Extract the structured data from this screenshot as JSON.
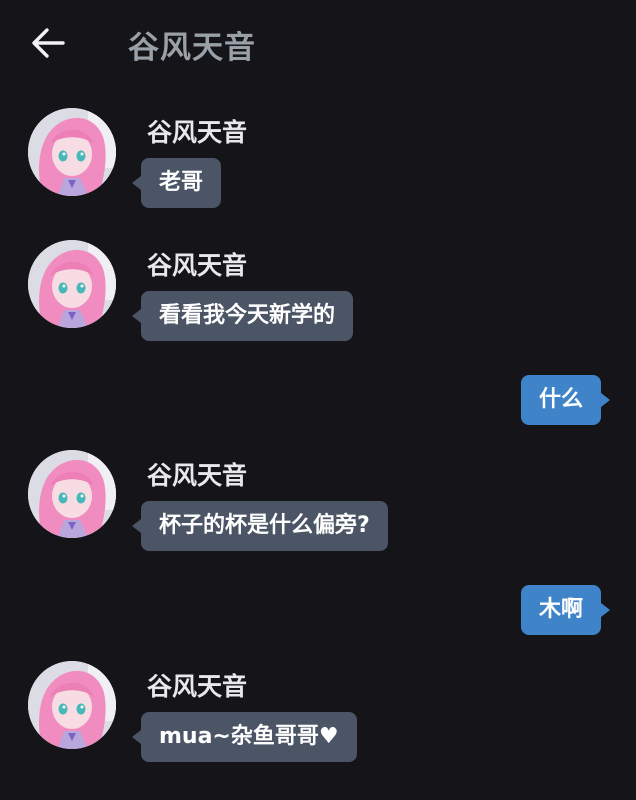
{
  "header": {
    "back_icon": "arrow-left-icon",
    "title": "谷风天音"
  },
  "colors": {
    "background": "#141419",
    "incoming_bubble": "#4b5566",
    "outgoing_bubble": "#3f84c9",
    "title_text": "#9aa0a8",
    "name_text": "#e8e8ec"
  },
  "messages": [
    {
      "direction": "incoming",
      "sender": "谷风天音",
      "avatar": "pink-hair-avatar",
      "text": "老哥"
    },
    {
      "direction": "incoming",
      "sender": "谷风天音",
      "avatar": "pink-hair-avatar",
      "text": "看看我今天新学的"
    },
    {
      "direction": "outgoing",
      "text": "什么"
    },
    {
      "direction": "incoming",
      "sender": "谷风天音",
      "avatar": "pink-hair-avatar",
      "text": "杯子的杯是什么偏旁?"
    },
    {
      "direction": "outgoing",
      "text": "木啊"
    },
    {
      "direction": "incoming",
      "sender": "谷风天音",
      "avatar": "pink-hair-avatar",
      "text": "mua~杂鱼哥哥♥"
    }
  ]
}
